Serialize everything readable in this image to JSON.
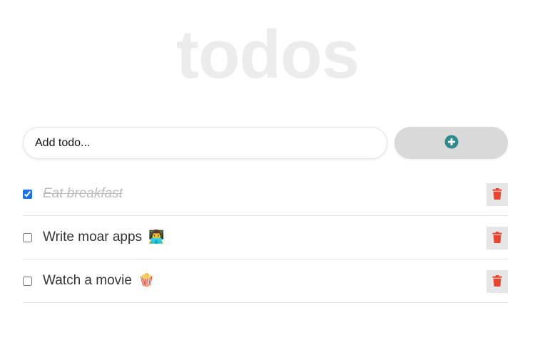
{
  "app": {
    "title": "todos"
  },
  "input": {
    "placeholder": "Add todo...",
    "value": ""
  },
  "add_button": {
    "icon": "plus-circle-icon",
    "icon_color": "#2e8b8b"
  },
  "todos": [
    {
      "text": "Eat breakfast",
      "emoji": "",
      "done": true
    },
    {
      "text": "Write moar apps",
      "emoji": "👨‍💻",
      "done": false
    },
    {
      "text": "Watch a movie",
      "emoji": "🍿",
      "done": false
    }
  ],
  "colors": {
    "title": "#ececec",
    "delete_icon": "#e8452e",
    "delete_bg": "#e6e6e6",
    "add_button_bg": "#d9d9d9",
    "done_text": "#bdbdbd",
    "checkbox_accent": "#1a73e8"
  },
  "icons": {
    "delete": "trash-icon"
  }
}
